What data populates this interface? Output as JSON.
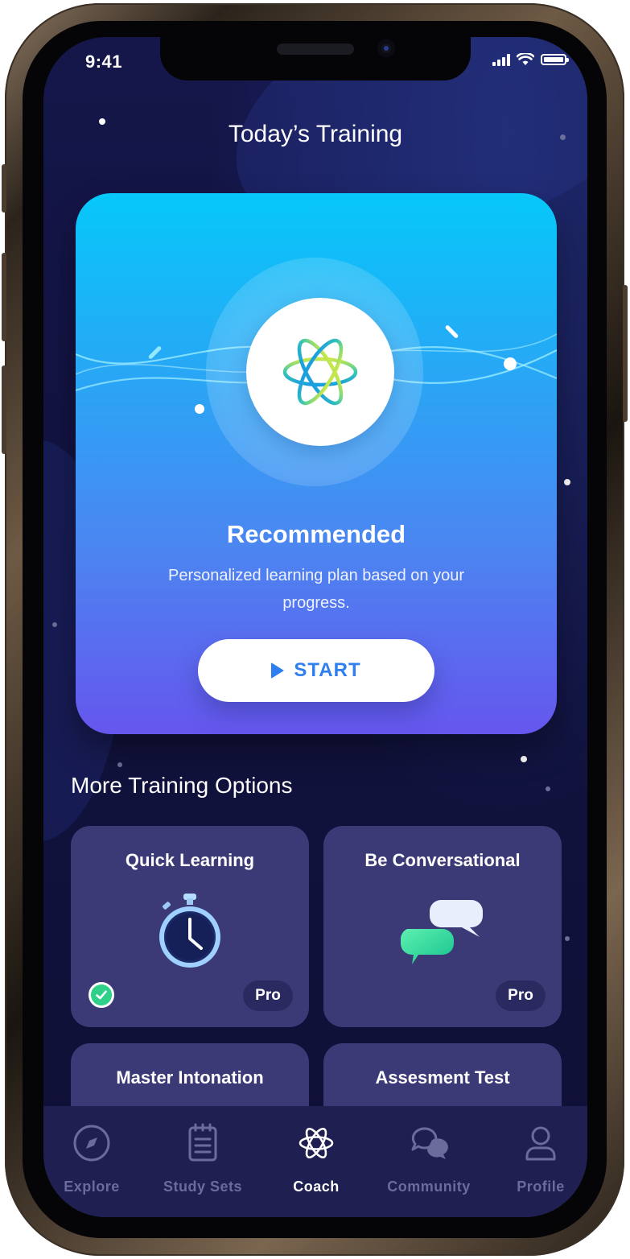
{
  "status": {
    "time": "9:41"
  },
  "header": {
    "title": "Today’s Training"
  },
  "hero": {
    "title": "Recommended",
    "subtitle": "Personalized learning plan based on your progress.",
    "start_label": "START"
  },
  "more": {
    "title": "More Training Options",
    "cards": [
      {
        "title": "Quick Learning",
        "badge": "Pro",
        "completed": true
      },
      {
        "title": "Be Conversational",
        "badge": "Pro",
        "completed": false
      },
      {
        "title": "Master Intonation"
      },
      {
        "title": "Assesment Test"
      }
    ]
  },
  "tabs": [
    {
      "label": "Explore",
      "icon": "compass-icon",
      "active": false
    },
    {
      "label": "Study Sets",
      "icon": "notepad-icon",
      "active": false
    },
    {
      "label": "Coach",
      "icon": "coach-atom-icon",
      "active": true
    },
    {
      "label": "Community",
      "icon": "chat-bubbles-icon",
      "active": false
    },
    {
      "label": "Profile",
      "icon": "person-icon",
      "active": false
    }
  ],
  "colors": {
    "background": "#13144a",
    "card": "#3b3a76",
    "accent": "#2f7ff0",
    "success": "#2fd08a",
    "tab_bar": "#1f1f52"
  }
}
